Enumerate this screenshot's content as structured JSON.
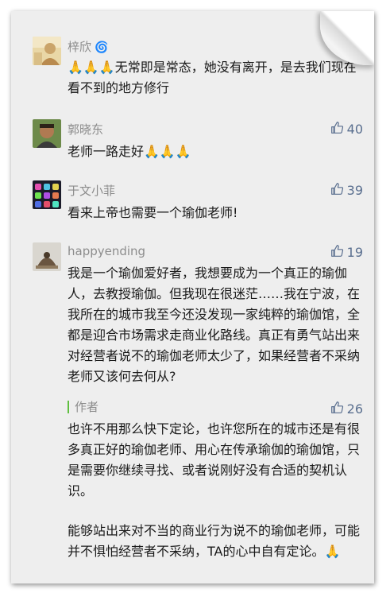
{
  "comments": [
    {
      "name": "梓欣",
      "badge": "🌀",
      "likes": "",
      "text": "🙏🙏🙏无常即是常态，她没有离开，是去我们现在看不到的地方修行"
    },
    {
      "name": "郭晓东",
      "likes": "40",
      "text": "老师一路走好🙏🙏🙏"
    },
    {
      "name": "于文小菲",
      "likes": "39",
      "text": "看来上帝也需要一个瑜伽老师!"
    },
    {
      "name": "happyending",
      "likes": "19",
      "text": "我是一个瑜伽爱好者，我想要成为一个真正的瑜伽人，去教授瑜伽。但我现在很迷茫……我在宁波，在我所在的城市我至今还没发现一家纯粹的瑜伽馆，全都是迎合市场需求走商业化路线。真正有勇气站出来对经营者说不的瑜伽老师太少了，如果经营者不采纳老师又该何去何从?"
    }
  ],
  "reply": {
    "label": "作者",
    "likes": "26",
    "text_1": "也许不用那么快下定论，也许您所在的城市还是有很多真正好的瑜伽老师、用心在传承瑜伽的瑜伽馆，只是需要你继续寻找、或者说刚好没有合适的契机认识。",
    "text_2": "能够站出来对不当的商业行为说不的瑜伽老师，可能并不惧怕经营者不采纳，TA的心中自有定论。🙏"
  },
  "colors": {
    "background": "#eeeeee",
    "name_gray": "#8c8c8c",
    "like_blue": "#5a6f8f",
    "author_green": "#5fbf3f"
  },
  "icons": {
    "like": "thumbs-up-icon"
  }
}
